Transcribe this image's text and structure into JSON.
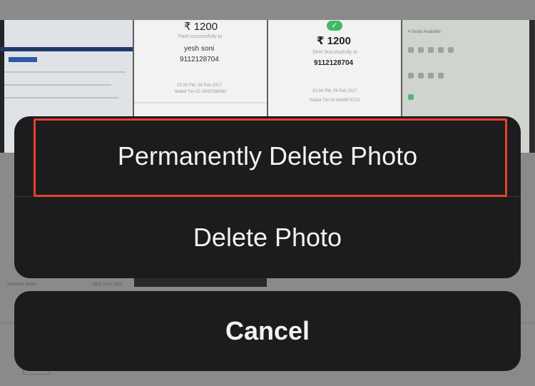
{
  "background": {
    "thumb2": {
      "amount": "₹ 1200",
      "caption": "Paid successfully to",
      "name": "yesh soni",
      "phone": "9112128704",
      "time": "10:33 PM, 09 Feb 2017",
      "txn": "Wallet Txn ID: 6542598582"
    },
    "thumb3": {
      "amount": "₹ 1200",
      "caption": "Sent Successfully to",
      "phone": "9112128704",
      "time": "10:34 PM, 09 Feb 2017",
      "txn": "Wallet Txn ID 6446976710"
    },
    "thumb4": {
      "header": "4 Seats Available"
    },
    "selected_seats_label": "Selected Seats",
    "seat_codes": "M16, M15, M14"
  },
  "action_sheet": {
    "permanently_delete_label": "Permanently Delete Photo",
    "delete_label": "Delete Photo",
    "cancel_label": "Cancel",
    "highlight_color": "#e8402c",
    "sheet_color": "#1c1c1e"
  }
}
